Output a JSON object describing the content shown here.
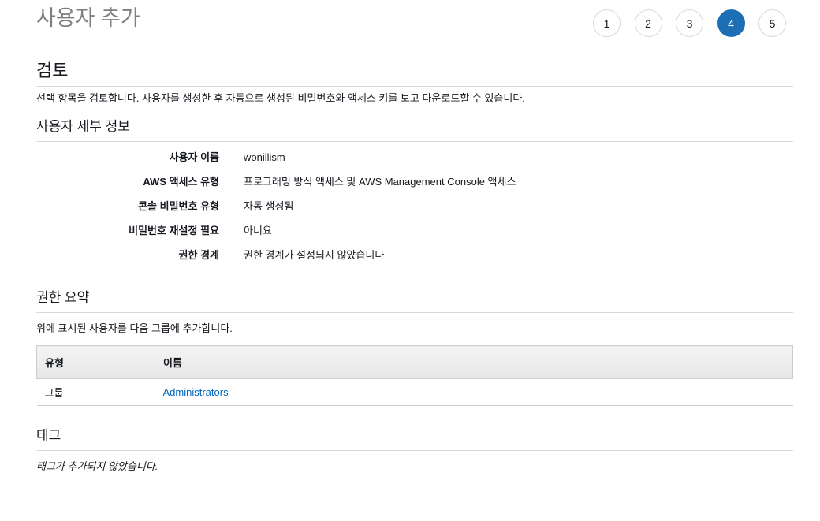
{
  "page_title": "사용자 추가",
  "steps": [
    "1",
    "2",
    "3",
    "4",
    "5"
  ],
  "active_step": "4",
  "review": {
    "heading": "검토",
    "description": "선택 항목을 검토합니다. 사용자를 생성한 후 자동으로 생성된 비밀번호와 액세스 키를 보고 다운로드할 수 있습니다."
  },
  "user_details": {
    "heading": "사용자 세부 정보",
    "rows": [
      {
        "label": "사용자 이름",
        "value": "wonillism"
      },
      {
        "label": "AWS 액세스 유형",
        "value": "프로그래밍 방식 액세스 및 AWS Management Console 액세스"
      },
      {
        "label": "콘솔 비밀번호 유형",
        "value": "자동 생성됨"
      },
      {
        "label": "비밀번호 재설정 필요",
        "value": "아니요"
      },
      {
        "label": "권한 경계",
        "value": "권한 경계가 설정되지 않았습니다"
      }
    ]
  },
  "permissions": {
    "heading": "권한 요약",
    "description": "위에 표시된 사용자를 다음 그룹에 추가합니다.",
    "columns": [
      "유형",
      "이름"
    ],
    "rows": [
      {
        "type": "그룹",
        "name": "Administrators"
      }
    ]
  },
  "tags": {
    "heading": "태그",
    "empty_text": "태그가 추가되지 않았습니다."
  },
  "colors": {
    "accent": "#1d6fb5",
    "link": "#0066c0"
  }
}
